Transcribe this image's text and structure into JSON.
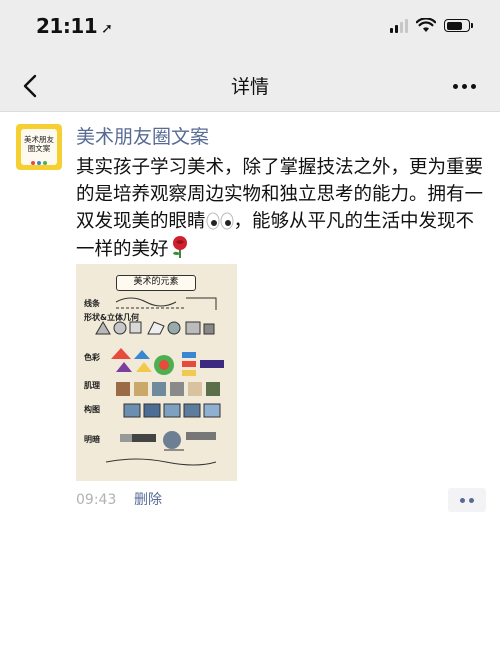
{
  "status_bar": {
    "time": "21:11",
    "location_arrow": "➚",
    "battery_level": 0.75
  },
  "nav": {
    "title": "详情",
    "back_icon": "chevron-left-icon",
    "more_icon": "more-dots-icon"
  },
  "post": {
    "avatar_text": "美术朋友圈文案",
    "author": "美术朋友圈文案",
    "content_before_eyes": "其实孩子学习美术，除了掌握技法之外，更为重要的是培养观察周边实物和独立思考的能力。拥有一双发现美的眼睛",
    "content_after_eyes": "，能够从平凡的生活中发现不一样的美好",
    "emoji_eyes": "eyes-emoji",
    "emoji_rose": "rose-emoji",
    "image": {
      "title": "美术的元素",
      "row_labels": [
        "线条",
        "形状&立体几何",
        "色彩",
        "肌理",
        "构图",
        "明暗"
      ]
    },
    "time": "09:43",
    "delete_label": "删除",
    "comment_icon": "comment-dots-icon"
  },
  "colors": {
    "nav_bg": "#ededed",
    "link": "#576b95",
    "meta": "#b2b2b2",
    "avatar_bg": "#f6d033"
  }
}
